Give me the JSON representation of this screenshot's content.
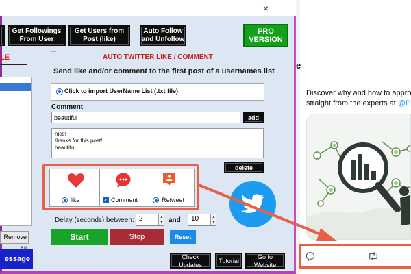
{
  "window": {
    "close_glyph": "×"
  },
  "toolbar": {
    "btn1": "Get Followings From User",
    "btn2": "Get Users from Post (like)",
    "btn3": "Auto Follow and Unfollow",
    "pro": "PRO VERSION"
  },
  "left_panel": {
    "tab_label": "LE",
    "remove_all": "Remove All",
    "message_btn": "essage"
  },
  "main": {
    "dash": "--",
    "section_title": "AUTO TWITTER LIKE / COMMENT",
    "subtitle": "Send like and/or comment to the first post of a usernames list",
    "import_label": "Click to import UserName List (.txt file)",
    "comment_label": "Comment",
    "comment_input_value": "beautiful",
    "add_label": "add",
    "comments": [
      "nice!",
      "thanks for this post!",
      "beautiful"
    ],
    "delete_label": "delete"
  },
  "actions": {
    "like_label": "like",
    "comment_label": "Comment",
    "retweet_label": "Retweet",
    "like_icon": "heart-icon",
    "comment_icon": "speech-bubble-icon",
    "retweet_icon": "retweet-icon"
  },
  "delay": {
    "label": "Delay (seconds) between:",
    "from": "2",
    "and_label": "and",
    "to": "10"
  },
  "controls": {
    "start": "Start",
    "stop": "Stop",
    "reset": "Reset",
    "check_updates": "Check Updates",
    "tutorial": "Tutorial",
    "website": "Go to Website"
  },
  "browser": {
    "heading": "e",
    "tweet_line1": "Discover why and how to approac",
    "tweet_line2_prefix": "straight from the experts at ",
    "tweet_mention": "@Pris"
  },
  "colors": {
    "window_border": "#b046b6",
    "panel_bg": "#dde7f3",
    "highlight": "#e86047",
    "twitter_blue": "#1d9bf0",
    "start_green": "#1aa329",
    "stop_red": "#a92b35",
    "pro_green": "#13a11c"
  }
}
